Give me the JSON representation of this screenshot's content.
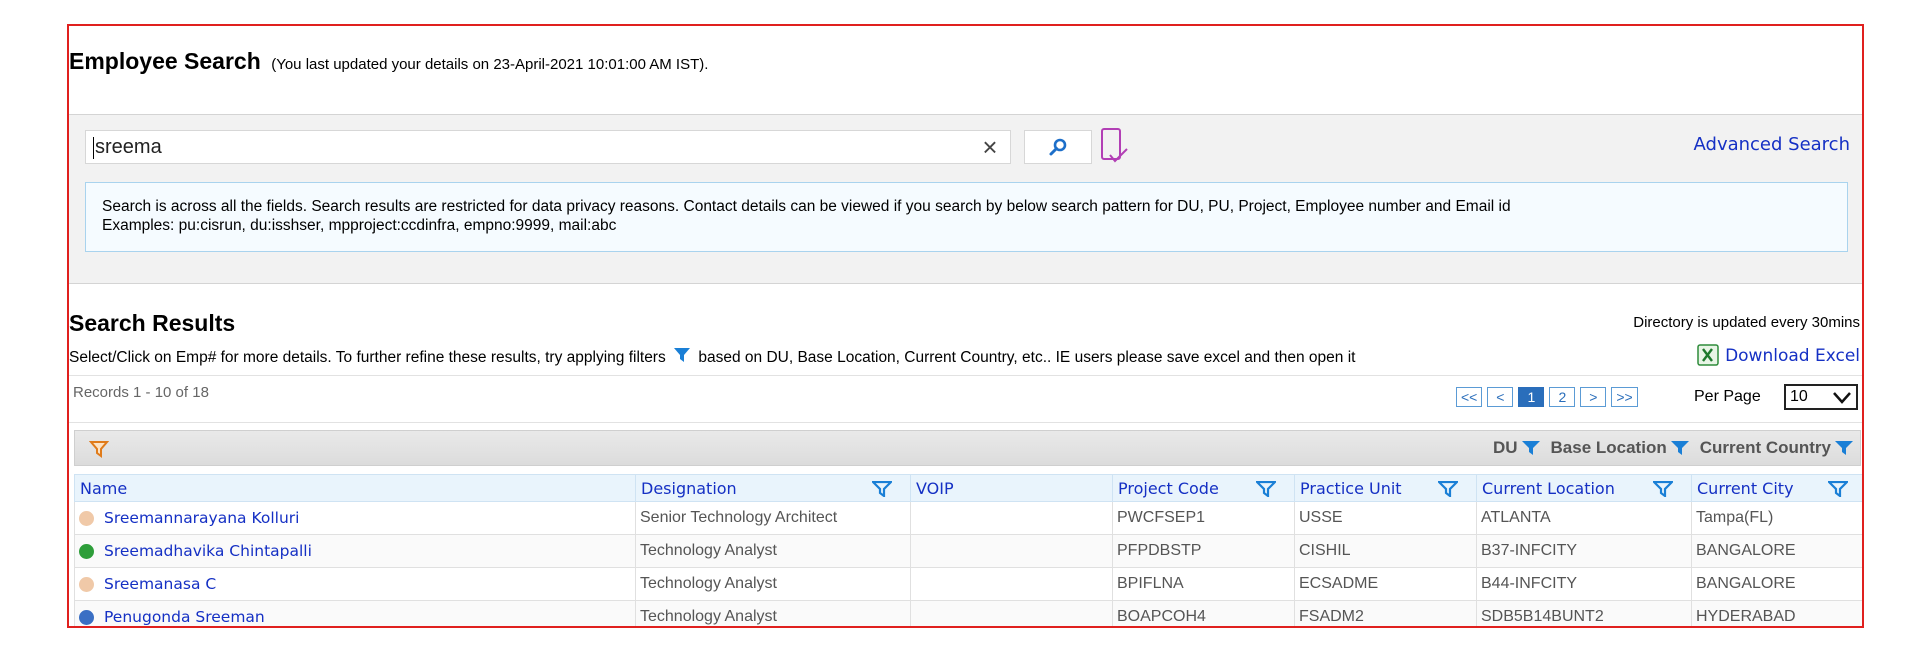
{
  "header": {
    "title": "Employee Search",
    "subtitle": "(You last updated your details on 23-April-2021 10:01:00 AM IST)."
  },
  "search": {
    "value": "sreema",
    "clear_icon": "×",
    "advanced_label": "Advanced Search",
    "info_line1": "Search is across all the fields. Search results are restricted for data privacy reasons. Contact details can be viewed if you search by below search pattern for DU, PU, Project, Employee number and Email id",
    "info_line2": "Examples: pu:cisrun, du:isshser, mpproject:ccdinfra, empno:9999, mail:abc"
  },
  "results": {
    "title": "Search Results",
    "directory_note": "Directory is updated every 30mins",
    "instruction_before": "Select/Click on Emp# for more details. To further refine these results, try applying filters",
    "instruction_after": "based on DU, Base Location, Current Country, etc.. IE users please save excel and then open it",
    "download_label": "Download Excel",
    "records_text": "Records 1 - 10 of 18"
  },
  "pagination": {
    "first": "<<",
    "prev": "<",
    "pages": [
      "1",
      "2"
    ],
    "active_page": "1",
    "next": ">",
    "last": ">>",
    "per_page_label": "Per Page",
    "per_page_value": "10"
  },
  "facets": [
    "DU",
    "Base Location",
    "Current Country"
  ],
  "table": {
    "columns": [
      "Name",
      "Designation",
      "VOIP",
      "Project Code",
      "Practice Unit",
      "Current Location",
      "Current City"
    ],
    "rows": [
      {
        "status_color": "#f0c9a8",
        "name": "Sreemannarayana Kolluri",
        "designation": "Senior Technology Architect",
        "voip": "",
        "project_code": "PWCFSEP1",
        "practice_unit": "USSE",
        "current_location": "ATLANTA",
        "current_city": "Tampa(FL)"
      },
      {
        "status_color": "#2e9e3a",
        "name": "Sreemadhavika Chintapalli",
        "designation": "Technology Analyst",
        "voip": "",
        "project_code": "PFPDBSTP",
        "practice_unit": "CISHIL",
        "current_location": "B37-INFCITY",
        "current_city": "BANGALORE"
      },
      {
        "status_color": "#f0c9a8",
        "name": "Sreemanasa C",
        "designation": "Technology Analyst",
        "voip": "",
        "project_code": "BPIFLNA",
        "practice_unit": "ECSADME",
        "current_location": "B44-INFCITY",
        "current_city": "BANGALORE"
      },
      {
        "status_color": "#3a6fc4",
        "name": "Penugonda Sreeman",
        "designation": "Technology Analyst",
        "voip": "",
        "project_code": "BOAPCOH4",
        "practice_unit": "FSADM2",
        "current_location": "SDB5B14BUNT2",
        "current_city": "HYDERABAD"
      }
    ]
  },
  "colors": {
    "frame_border": "#e0201e",
    "link_blue": "#1530c4",
    "filter_icon_blue": "#1a7fd6",
    "filter_icon_orange": "#e07b1a"
  }
}
